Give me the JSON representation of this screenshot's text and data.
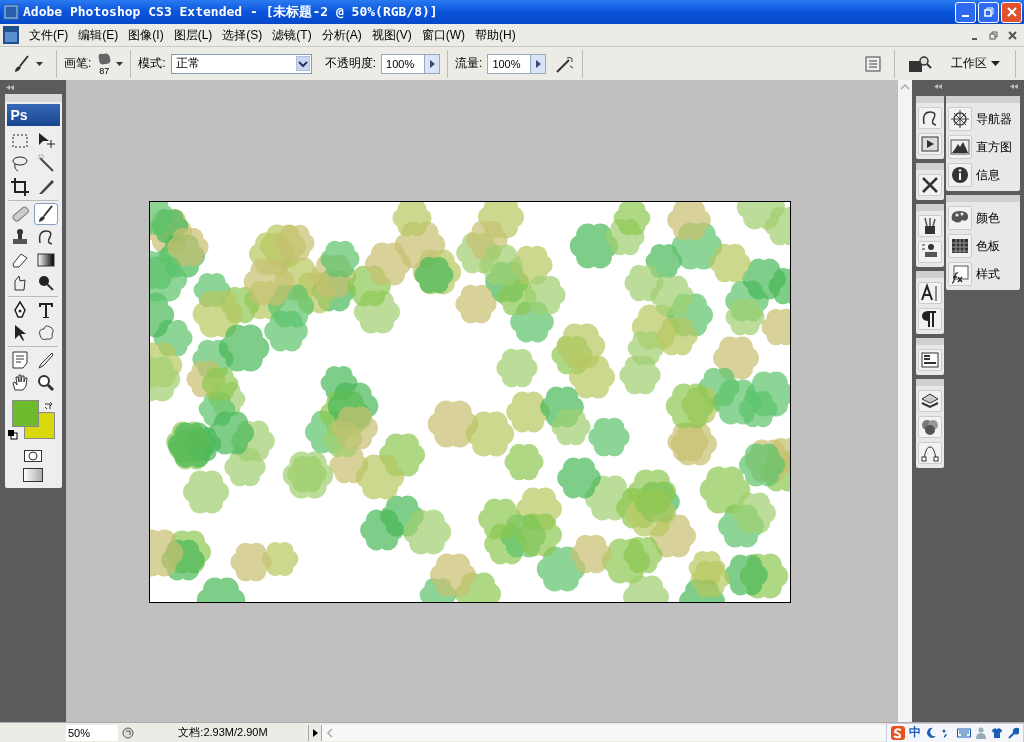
{
  "window": {
    "title": "Adobe Photoshop CS3 Extended - [未标题-2 @ 50%(RGB/8)]"
  },
  "menu": [
    "文件(F)",
    "编辑(E)",
    "图像(I)",
    "图层(L)",
    "选择(S)",
    "滤镜(T)",
    "分析(A)",
    "视图(V)",
    "窗口(W)",
    "帮助(H)"
  ],
  "options_bar": {
    "brush_label": "画笔:",
    "brush_size": "87",
    "mode_label": "模式:",
    "mode": "正常",
    "opacity_label": "不透明度:",
    "opacity": "100%",
    "flow_label": "流量:",
    "flow": "100%",
    "workspace": "工作区"
  },
  "toolbox": {
    "logo": "Ps",
    "tools": [
      {
        "kind": "marquee",
        "selected": false
      },
      {
        "kind": "move",
        "selected": false
      },
      {
        "kind": "lasso",
        "selected": false
      },
      {
        "kind": "wand",
        "selected": false
      },
      {
        "kind": "crop",
        "selected": false
      },
      {
        "kind": "slice",
        "selected": false
      },
      {
        "kind": "bandage",
        "selected": false
      },
      {
        "kind": "brush",
        "selected": true
      },
      {
        "kind": "stamp",
        "selected": false
      },
      {
        "kind": "history",
        "selected": false
      },
      {
        "kind": "eraser",
        "selected": false
      },
      {
        "kind": "gradient",
        "selected": false
      },
      {
        "kind": "smudge",
        "selected": false
      },
      {
        "kind": "dodge",
        "selected": false
      },
      {
        "kind": "pen",
        "selected": false
      },
      {
        "kind": "type",
        "selected": false
      },
      {
        "kind": "arrow",
        "selected": false
      },
      {
        "kind": "shape",
        "selected": false
      },
      {
        "kind": "note",
        "selected": false
      },
      {
        "kind": "eyedropper",
        "selected": false
      },
      {
        "kind": "hand",
        "selected": false
      },
      {
        "kind": "zoom",
        "selected": false
      }
    ]
  },
  "dock_icons": [
    [
      {
        "kind": "history"
      },
      {
        "kind": "actions"
      }
    ],
    [
      {
        "kind": "tools"
      }
    ],
    [
      {
        "kind": "brushes"
      },
      {
        "kind": "clone"
      }
    ],
    [
      {
        "kind": "character"
      },
      {
        "kind": "paragraph"
      }
    ],
    [
      {
        "kind": "layercomps"
      }
    ],
    [
      {
        "kind": "layers"
      },
      {
        "kind": "channels"
      },
      {
        "kind": "paths"
      }
    ]
  ],
  "panels": [
    [
      {
        "kind": "navigator",
        "label": "导航器"
      },
      {
        "kind": "histogram",
        "label": "直方图"
      },
      {
        "kind": "info",
        "label": "信息"
      }
    ],
    [
      {
        "kind": "color",
        "label": "颜色"
      },
      {
        "kind": "swatches",
        "label": "色板"
      },
      {
        "kind": "styles",
        "label": "样式"
      }
    ]
  ],
  "status_bar": {
    "zoom": "50%",
    "document": "文档:2.93M/2.90M"
  },
  "ime_bar": {
    "mode": "中"
  }
}
